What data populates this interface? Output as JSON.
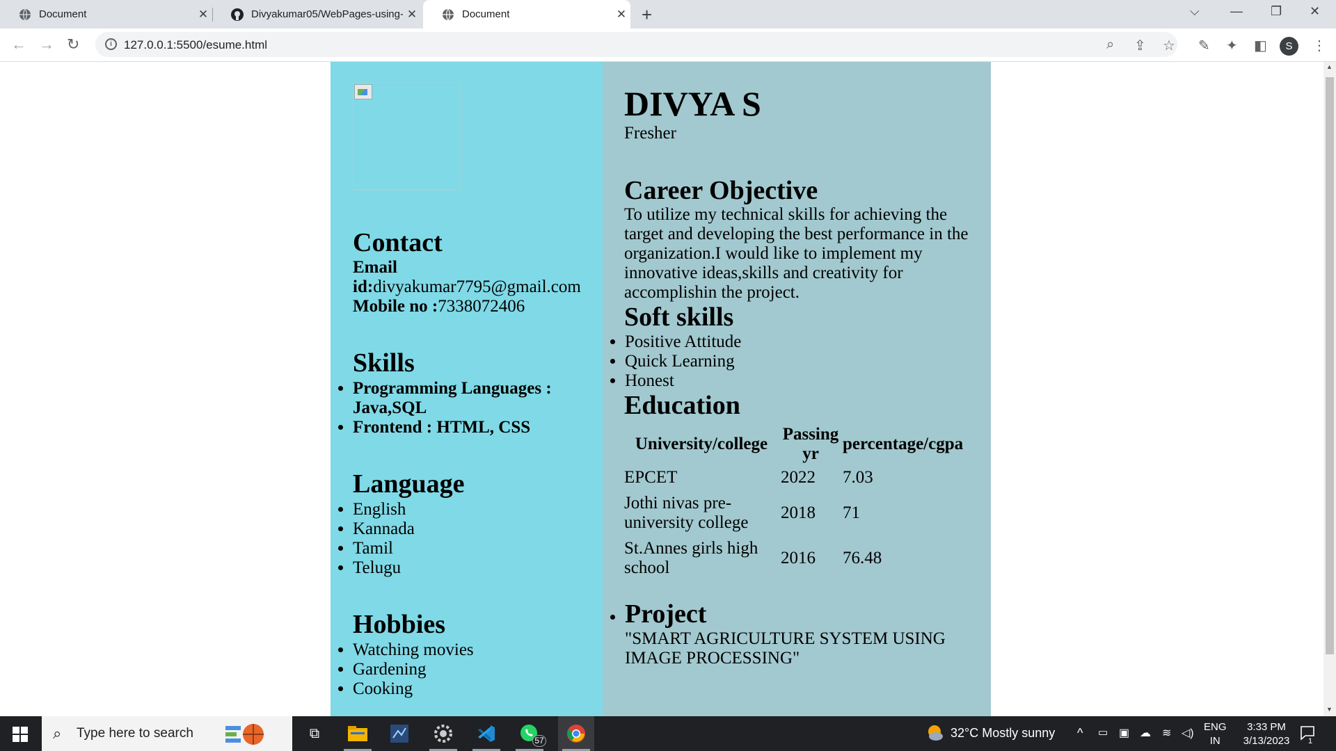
{
  "browser": {
    "tabs": [
      {
        "title": "Document",
        "active": false
      },
      {
        "title": "Divyakumar05/WebPages-using-",
        "active": false
      },
      {
        "title": "Document",
        "active": true
      }
    ],
    "url": "127.0.0.1:5500/esume.html"
  },
  "resume": {
    "name": "DIVYA S",
    "designation": "Fresher",
    "contact": {
      "heading": "Contact",
      "email_label": "Email id:",
      "email": "divyakumar7795@gmail.com",
      "mobile_label": "Mobile no :",
      "mobile": "7338072406"
    },
    "skills": {
      "heading": "Skills",
      "items": [
        "Programming Languages : Java,SQL",
        "Frontend : HTML, CSS"
      ]
    },
    "language": {
      "heading": "Language",
      "items": [
        "English",
        "Kannada",
        "Tamil",
        "Telugu"
      ]
    },
    "hobbies": {
      "heading": "Hobbies",
      "items": [
        "Watching movies",
        "Gardening",
        "Cooking"
      ]
    },
    "career": {
      "heading": "Career Objective",
      "text": "To utilize my technical skills for achieving the target and developing the best performance in the organization.I would like to implement my innovative ideas,skills and creativity for accomplishin the project."
    },
    "soft_skills": {
      "heading": "Soft skills",
      "items": [
        "Positive Attitude",
        "Quick Learning",
        "Honest"
      ]
    },
    "education": {
      "heading": "Education",
      "headers": [
        "University/college",
        "Passing yr",
        "percentage/cgpa"
      ],
      "rows": [
        [
          "EPCET",
          "2022",
          "7.03"
        ],
        [
          "Jothi nivas pre-university college",
          "2018",
          "71"
        ],
        [
          "St.Annes girls high school",
          "2016",
          "76.48"
        ]
      ]
    },
    "project": {
      "heading": "Project",
      "text": "\"SMART AGRICULTURE SYSTEM USING IMAGE PROCESSING\""
    }
  },
  "taskbar": {
    "search_placeholder": "Type here to search",
    "whatsapp_badge": "57",
    "weather": "32°C  Mostly sunny",
    "lang": "ENG",
    "region": "IN",
    "time": "3:33 PM",
    "date": "3/13/2023",
    "notif_count": "1"
  },
  "colors": {
    "left_panel": "#80d9e6",
    "right_panel": "#a2c9cf"
  }
}
